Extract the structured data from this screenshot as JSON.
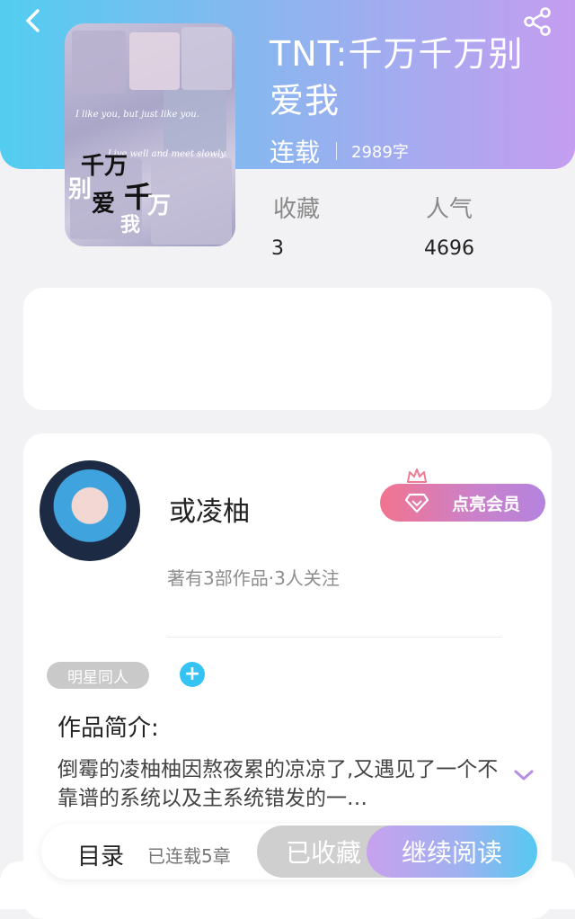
{
  "book": {
    "title": "TNT:千万千万别爱我",
    "status": "连载",
    "word_count": "2989字",
    "cover": {
      "big_text": [
        "千万",
        "千",
        "爱",
        "万",
        "别",
        "我"
      ],
      "lines": [
        "I like you, but just like you.",
        "Live well and meet slowly."
      ]
    }
  },
  "stats": {
    "favorites_label": "收藏",
    "favorites_value": "3",
    "popularity_label": "人气",
    "popularity_value": "4696"
  },
  "author": {
    "name": "或凌柚",
    "meta": "著有3部作品·3人关注",
    "vip_button": "点亮会员"
  },
  "tag": "明星同人",
  "intro": {
    "title": "作品简介:",
    "text": "倒霉的凌柚柚因熬夜累的凉凉了,又遇见了一个不靠谱的系统以及主系统错发的一…"
  },
  "actions": {
    "toc": "目录",
    "chapters": "已连载5章",
    "collected": "已收藏",
    "read": "继续阅读"
  },
  "colors": {
    "header_gradient": [
      "#52cdf0",
      "#c59df0"
    ],
    "vip_gradient": [
      "#f2738f",
      "#b483de"
    ],
    "tag_add": "#35c3f3"
  },
  "icons": [
    "back-arrow-icon",
    "share-icon",
    "crown-icon",
    "diamond-icon",
    "plus-icon",
    "chevron-down-icon"
  ]
}
